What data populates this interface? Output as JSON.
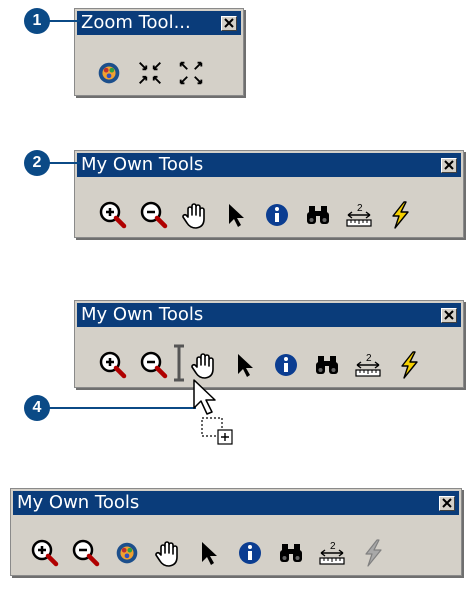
{
  "callouts": {
    "c1": "1",
    "c2": "2",
    "c4": "4"
  },
  "toolbars": [
    {
      "title": "Zoom Tool...",
      "tools": [
        "add-color-icon",
        "zoom-in-fixed-icon",
        "zoom-out-fixed-icon"
      ]
    },
    {
      "title": "My Own Tools",
      "tools": [
        "zoom-in-icon",
        "zoom-out-icon",
        "pan-icon",
        "select-arrow-icon",
        "info-icon",
        "find-binoculars-icon",
        "measure-icon",
        "lightning-icon"
      ]
    },
    {
      "title": "My Own Tools",
      "tools": [
        "zoom-in-icon",
        "zoom-out-icon",
        "insert-bar",
        "pan-icon",
        "select-arrow-icon",
        "info-icon",
        "find-binoculars-icon",
        "measure-icon",
        "lightning-icon"
      ]
    },
    {
      "title": "My Own Tools",
      "tools": [
        "zoom-in-icon",
        "zoom-out-icon",
        "add-color-icon",
        "pan-icon",
        "select-arrow-icon",
        "info-icon",
        "find-binoculars-icon",
        "measure-icon",
        "lightning-disabled-icon"
      ]
    }
  ],
  "colors": {
    "titlebar": "#0a3c7a",
    "callout": "#0b4a86",
    "toolbar_bg": "#d4d0c8"
  }
}
